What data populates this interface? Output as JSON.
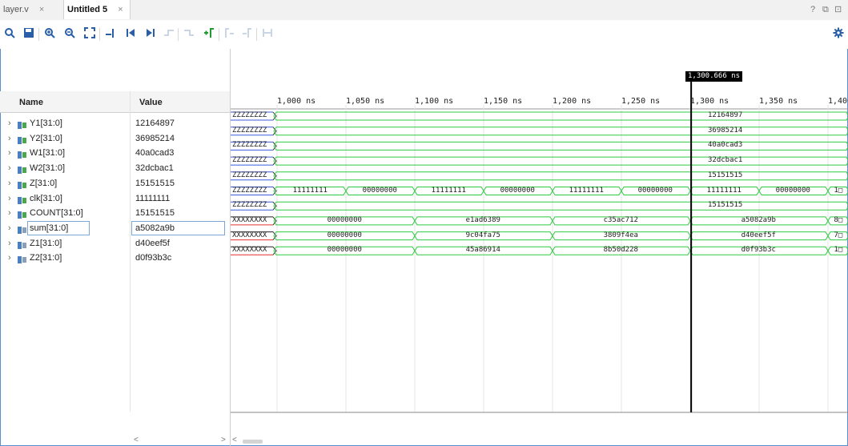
{
  "tabs": [
    {
      "label": "layer.v",
      "close": "×",
      "active": false
    },
    {
      "label": "Untitled 5",
      "close": "×",
      "active": true
    }
  ],
  "window_controls": [
    "?",
    "⧉",
    "⊡"
  ],
  "toolbar_icons": [
    "search-icon",
    "save-icon",
    "zoom-in-icon",
    "zoom-out-icon",
    "zoom-fit-icon",
    "go-to-cursor-icon",
    "go-to-first-icon",
    "go-to-last-icon",
    "previous-transition-icon",
    "next-transition-icon",
    "add-marker-icon",
    "previous-marker-icon",
    "next-marker-icon",
    "swap-cursors-icon",
    "settings-icon"
  ],
  "columns": {
    "name": "Name",
    "value": "Value"
  },
  "cursor_time": "1,300.666 ns",
  "time_ticks": [
    "1,000 ns",
    "1,050 ns",
    "1,100 ns",
    "1,150 ns",
    "1,200 ns",
    "1,250 ns",
    "1,300 ns",
    "1,350 ns",
    "1,400"
  ],
  "signals": [
    {
      "name": "Y1[31:0]",
      "value": "12164897",
      "kind": "in"
    },
    {
      "name": "Y2[31:0]",
      "value": "36985214",
      "kind": "in"
    },
    {
      "name": "W1[31:0]",
      "value": "40a0cad3",
      "kind": "in"
    },
    {
      "name": "W2[31:0]",
      "value": "32dcbac1",
      "kind": "in"
    },
    {
      "name": "Z[31:0]",
      "value": "15151515",
      "kind": "in"
    },
    {
      "name": "clk[31:0]",
      "value": "11111111",
      "kind": "in"
    },
    {
      "name": "COUNT[31:0]",
      "value": "15151515",
      "kind": "in"
    },
    {
      "name": "sum[31:0]",
      "value": "a5082a9b",
      "kind": "out"
    },
    {
      "name": "Z1[31:0]",
      "value": "d40eef5f",
      "kind": "out"
    },
    {
      "name": "Z2[31:0]",
      "value": "d0f93b3c",
      "kind": "out"
    }
  ],
  "waves": [
    {
      "init": "ZZZZZZZZ",
      "labels": [
        "12164897"
      ]
    },
    {
      "init": "ZZZZZZZZ",
      "labels": [
        "36985214"
      ]
    },
    {
      "init": "ZZZZZZZZ",
      "labels": [
        "40a0cad3"
      ]
    },
    {
      "init": "ZZZZZZZZ",
      "labels": [
        "32dcbac1"
      ]
    },
    {
      "init": "ZZZZZZZZ",
      "labels": [
        "15151515"
      ]
    },
    {
      "init": "ZZZZZZZZ",
      "labels": [
        "11111111",
        "00000000",
        "11111111",
        "00000000",
        "11111111",
        "00000000",
        "11111111",
        "00000000",
        "1□"
      ]
    },
    {
      "init": "ZZZZZZZZ",
      "labels": [
        "15151515"
      ]
    },
    {
      "init": "XXXXXXXX",
      "labels": [
        "00000000",
        "e1ad6389",
        "c35ac712",
        "a5082a9b",
        "8□"
      ]
    },
    {
      "init": "XXXXXXXX",
      "labels": [
        "00000000",
        "9c04fa75",
        "3809f4ea",
        "d40eef5f",
        "7□"
      ]
    },
    {
      "init": "XXXXXXXX",
      "labels": [
        "00000000",
        "45a86914",
        "8b50d228",
        "d0f93b3c",
        "1□"
      ]
    }
  ],
  "colors": {
    "wave": "#2ecc40",
    "z_state": "#3b5bdb",
    "x_state": "#e03131",
    "cursor": "#000000"
  },
  "scroll": {
    "left": "<",
    "right": ">",
    "wave_left": "<"
  }
}
